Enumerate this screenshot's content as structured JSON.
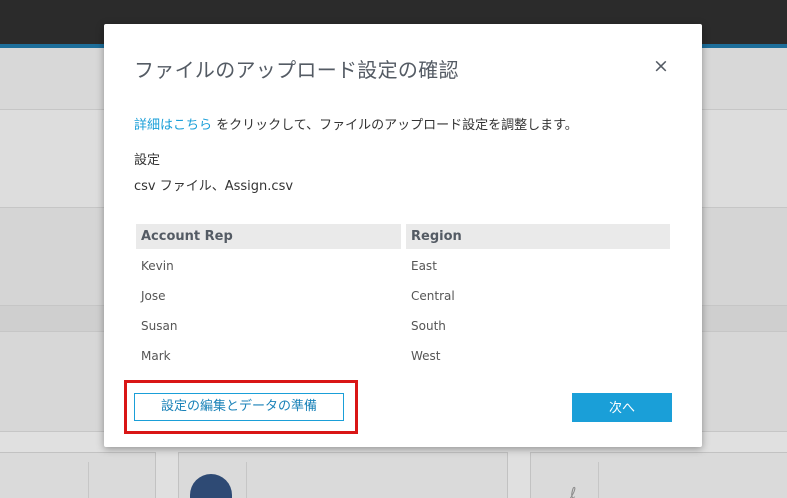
{
  "dialog": {
    "title": "ファイルのアップロード設定の確認",
    "close_glyph": "×",
    "info_link": "詳細はこちら",
    "info_text": " をクリックして、ファイルのアップロード設定を調整します。",
    "settings_heading": "設定",
    "settings_value": "csv ファイル、Assign.csv",
    "table": {
      "columns": [
        "Account Rep",
        "Region"
      ],
      "rows": [
        [
          "Kevin",
          "East"
        ],
        [
          "Jose",
          "Central"
        ],
        [
          "Susan",
          "South"
        ],
        [
          "Mark",
          "West"
        ]
      ]
    },
    "edit_button": "設定の編集とデータの準備",
    "next_button": "次へ"
  },
  "colors": {
    "accent": "#1a9fd8",
    "highlight": "#d91616",
    "topbar": "#2b2b2b"
  },
  "icons": {
    "close": "close-icon"
  }
}
